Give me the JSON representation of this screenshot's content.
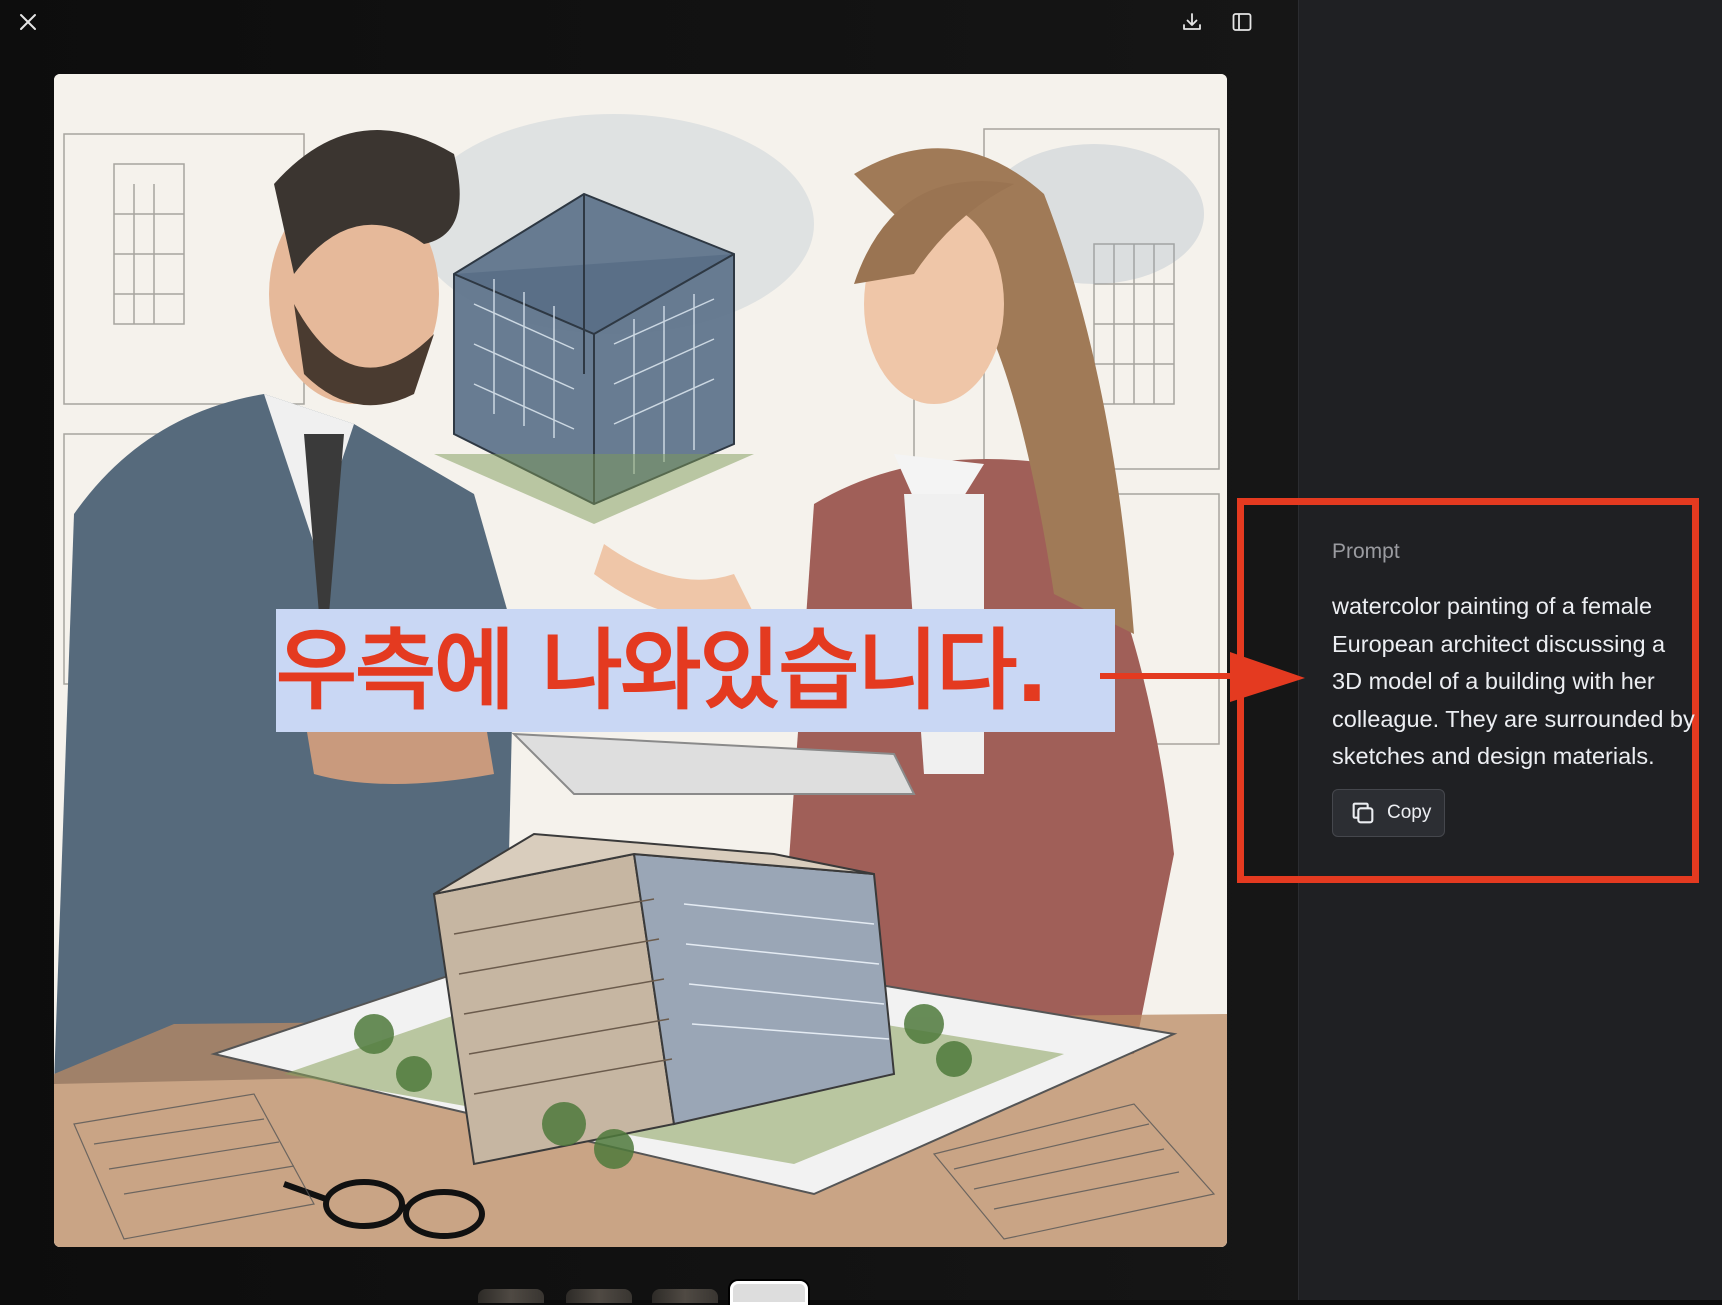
{
  "viewer": {
    "close_icon": "close-icon",
    "download_icon": "download-icon",
    "sidebar_toggle_icon": "sidebar-toggle-icon",
    "image_description_icon": "generated-image-watercolor-architects"
  },
  "annotation": {
    "caption": "우측에 나와있습니다.",
    "caption_color": "#e43a20",
    "caption_bg": "#c9d7f4",
    "highlight_color": "#e43a20"
  },
  "side_panel": {
    "prompt_label": "Prompt",
    "prompt_lines": [
      "watercolor painting of a female",
      "European architect discussing a",
      "3D model of a building with her",
      "colleague. They are surrounded by",
      "sketches and design materials."
    ],
    "copy_label": "Copy",
    "copy_icon": "copy-icon"
  },
  "thumbnails": {
    "count": 4,
    "active_index": 3
  }
}
